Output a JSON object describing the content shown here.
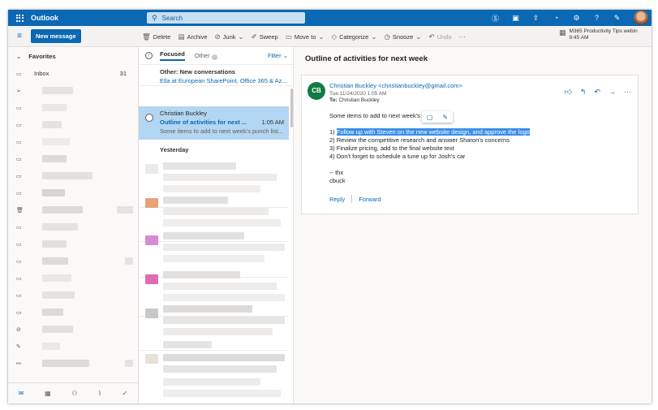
{
  "topbar": {
    "app_title": "Outlook",
    "search_placeholder": "Search"
  },
  "commandbar": {
    "new_message": "New message",
    "items": [
      {
        "label": "Delete",
        "icon": "trash-icon"
      },
      {
        "label": "Archive",
        "icon": "archive-icon"
      },
      {
        "label": "Junk",
        "icon": "junk-icon"
      },
      {
        "label": "Sweep",
        "icon": "sweep-icon"
      },
      {
        "label": "Move to",
        "icon": "move-icon"
      },
      {
        "label": "Categorize",
        "icon": "tag-icon"
      },
      {
        "label": "Snooze",
        "icon": "clock-icon"
      },
      {
        "label": "Undo",
        "icon": "undo-icon"
      }
    ],
    "promo_title": "M365 Productivity Tips webin",
    "promo_time": "9:45 AM"
  },
  "leftnav": {
    "favorites": "Favorites",
    "inbox_label": "Inbox",
    "inbox_count": "31"
  },
  "msglist": {
    "tab_focused": "Focused",
    "tab_other": "Other",
    "filter": "Filter",
    "other_convo_title": "Other: New conversations",
    "other_convo_from": "Ella at European SharePoint, Office 365 & Az...",
    "selected": {
      "from": "Christian Buckley",
      "subject": "Outline of activities for next ...",
      "time": "1:05 AM",
      "preview": "Some items to add to next week's punch list..."
    },
    "yesterday": "Yesterday"
  },
  "reading": {
    "subject": "Outline of activities for next week",
    "avatar_initials": "CB",
    "sender": "Christian Buckley <christianbuckley@gmail.com>",
    "date": "Tue 11/24/2020 1:05 AM",
    "to_prefix": "To:",
    "to_name": "Christian Buckley",
    "body_intro": "Some items to add to next week's",
    "body_intro_end": ":",
    "line1_prefix": "1) ",
    "line1_highlight": "Follow up with Steven on the new website design, and approve the logo",
    "line2": "2) Review the competitive research and answer Sharon's concerns",
    "line3": "3) Finalize pricing, add to the final website text",
    "line4": "4) Don't forget to schedule a tune up for Josh's car",
    "sign1": "-- thx",
    "sign2": "cbuck",
    "reply": "Reply",
    "forward": "Forward"
  }
}
